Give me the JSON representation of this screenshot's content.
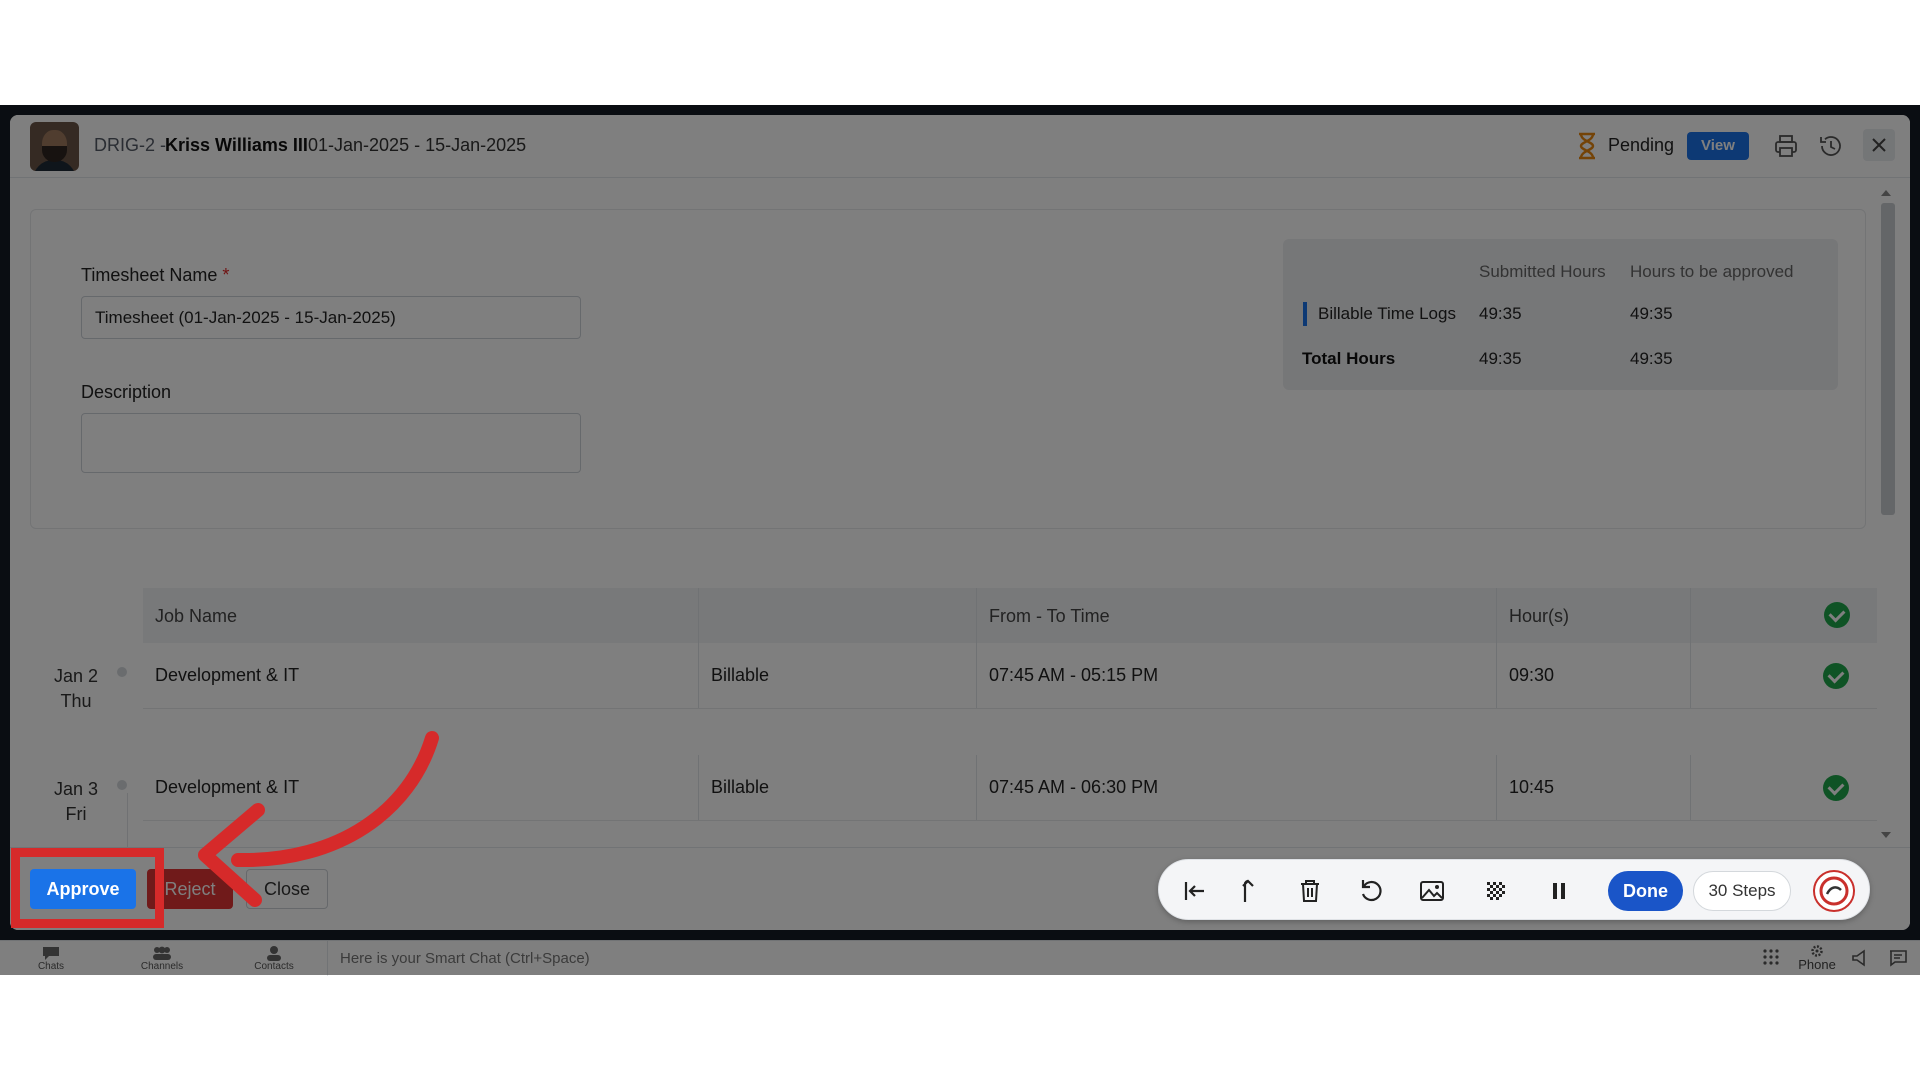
{
  "header": {
    "id_prefix": "DRIG-2 -",
    "employee_name": "Kriss Williams III",
    "date_range": "01-Jan-2025 - 15-Jan-2025",
    "status": "Pending",
    "view_label": "View"
  },
  "form": {
    "timesheet_name_label": "Timesheet Name",
    "required_mark": "*",
    "timesheet_name_value": "Timesheet (01-Jan-2025 - 15-Jan-2025)",
    "description_label": "Description",
    "description_value": ""
  },
  "hours_summary": {
    "col_submitted": "Submitted Hours",
    "col_to_approve": "Hours to be approved",
    "rows": [
      {
        "label": "Billable Time Logs",
        "submitted": "49:35",
        "to_approve": "49:35"
      },
      {
        "label": "Total Hours",
        "submitted": "49:35",
        "to_approve": "49:35"
      }
    ]
  },
  "table": {
    "headers": {
      "job_name": "Job Name",
      "type": "",
      "from_to": "From - To Time",
      "hours": "Hour(s)"
    },
    "rows": [
      {
        "day": "Jan 2",
        "weekday": "Thu",
        "job": "Development & IT",
        "type": "Billable",
        "time": "07:45 AM - 05:15 PM",
        "hours": "09:30"
      },
      {
        "day": "Jan 3",
        "weekday": "Fri",
        "job": "Development & IT",
        "type": "Billable",
        "time": "07:45 AM - 06:30 PM",
        "hours": "10:45"
      }
    ]
  },
  "footer": {
    "approve_label": "Approve",
    "reject_label": "Reject",
    "close_label": "Close"
  },
  "recorder": {
    "done_label": "Done",
    "steps_label": "30 Steps"
  },
  "chatbar": {
    "chats": "Chats",
    "channels": "Channels",
    "contacts": "Contacts",
    "smart_chat_placeholder": "Here is your Smart Chat (Ctrl+Space)",
    "phone": "Phone"
  },
  "colors": {
    "primary": "#1a73e8",
    "reject": "#e03434",
    "approved": "#1fa64a",
    "highlight": "#d62a2a"
  }
}
